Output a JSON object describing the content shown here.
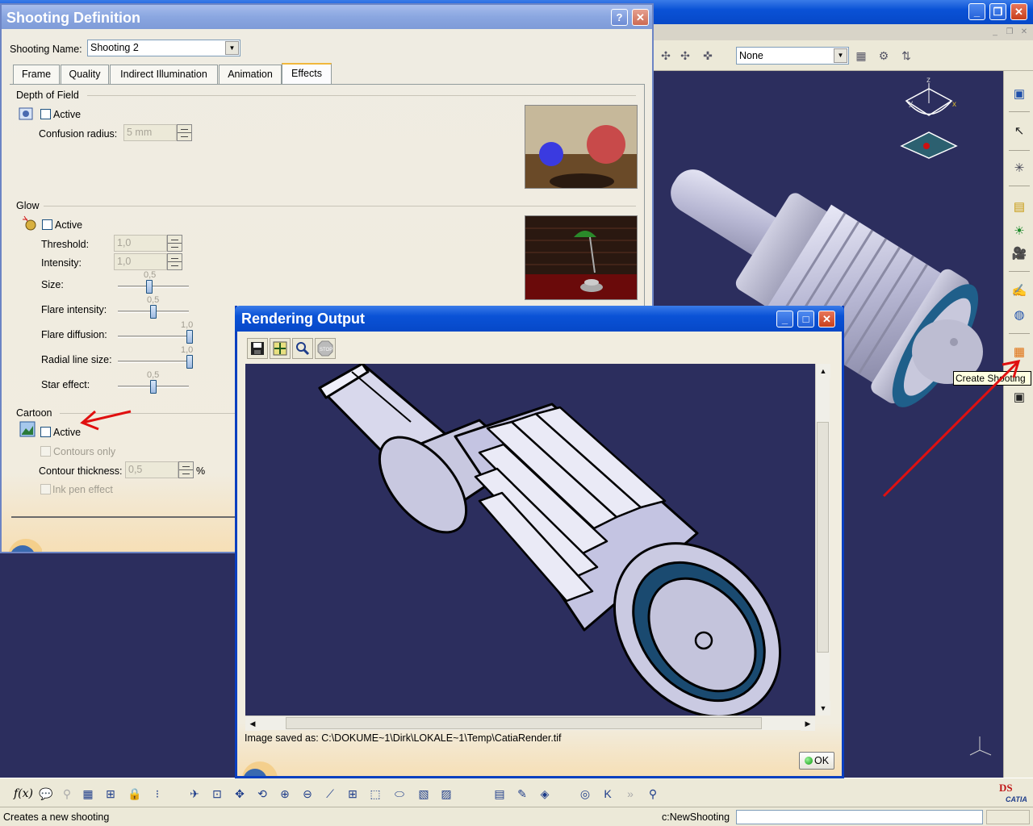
{
  "main": {
    "combo_value": "None",
    "tooltip": "Create Shooting",
    "status_text": "Creates a new shooting",
    "command_label": "c:NewShooting",
    "axis": {
      "z": "z",
      "y": "y",
      "x": "x"
    }
  },
  "shooting": {
    "title": "Shooting Definition",
    "help_button": "?",
    "close_button": "✕",
    "name_label": "Shooting Name:",
    "name_value": "Shooting 2",
    "tabs": [
      "Frame",
      "Quality",
      "Indirect Illumination",
      "Animation",
      "Effects"
    ],
    "active_tab": "Effects",
    "dof": {
      "title": "Depth of Field",
      "active_label": "Active",
      "confusion_label": "Confusion radius:",
      "confusion_value": "5 mm"
    },
    "glow": {
      "title": "Glow",
      "active_label": "Active",
      "threshold_label": "Threshold:",
      "threshold_value": "1,0",
      "intensity_label": "Intensity:",
      "intensity_value": "1,0",
      "size_label": "Size:",
      "size_value": "0,5",
      "flare_intensity_label": "Flare intensity:",
      "flare_intensity_value": "0,5",
      "flare_diffusion_label": "Flare diffusion:",
      "flare_diffusion_value": "1,0",
      "radial_label": "Radial line size:",
      "radial_value": "1,0",
      "star_label": "Star effect:",
      "star_value": "0,5"
    },
    "cartoon": {
      "title": "Cartoon",
      "active_label": "Active",
      "contours_label": "Contours only",
      "thickness_label": "Contour thickness:",
      "thickness_value": "0,5",
      "percent": "%",
      "inkpen_label": "Ink pen effect"
    }
  },
  "render": {
    "title": "Rendering Output",
    "saved_text": "Image saved as: C:\\DOKUME~1\\Dirk\\LOKALE~1\\Temp\\CatiaRender.tif",
    "ok_label": "OK",
    "stop_label": "STOP"
  },
  "colors": {
    "viewport_bg": "#2c2e5e",
    "xp_title": "#0a52d6",
    "inactive_title": "#8aa6e0",
    "annotation_arrow": "#e01010"
  },
  "icons": {
    "dof": "depth-of-field-icon",
    "glow": "glow-icon",
    "cartoon": "cartoon-icon",
    "save": "save-icon",
    "fit": "fit-all-icon",
    "zoom": "zoom-icon",
    "stop": "stop-icon"
  }
}
